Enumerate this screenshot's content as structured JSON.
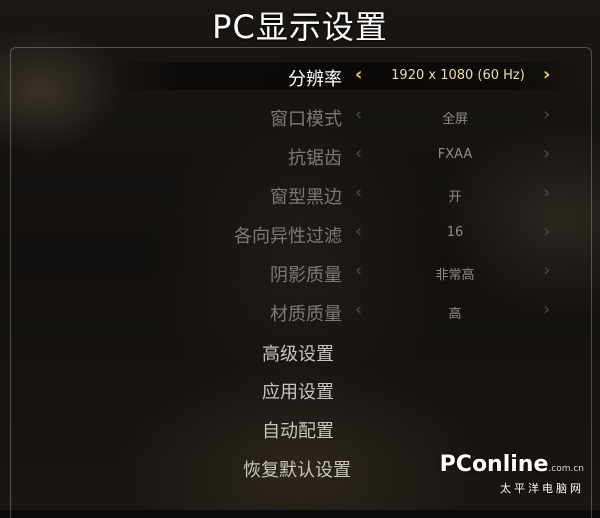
{
  "title": "PC显示设置",
  "settings": [
    {
      "label": "分辨率",
      "value": "1920 x 1080 (60 Hz)",
      "selected": true
    },
    {
      "label": "窗口模式",
      "value": "全屏",
      "selected": false
    },
    {
      "label": "抗锯齿",
      "value": "FXAA",
      "selected": false
    },
    {
      "label": "窗型黑边",
      "value": "开",
      "selected": false
    },
    {
      "label": "各向异性过滤",
      "value": "16",
      "selected": false
    },
    {
      "label": "阴影质量",
      "value": "非常高",
      "selected": false
    },
    {
      "label": "材质质量",
      "value": "高",
      "selected": false
    }
  ],
  "arrows": {
    "left": "‹",
    "right": "›"
  },
  "actions": [
    {
      "label": "高级设置"
    },
    {
      "label": "应用设置"
    },
    {
      "label": "自动配置"
    },
    {
      "label": "恢复默认设置"
    }
  ],
  "watermark": {
    "brand": "PConline",
    "domain": ".com.cn",
    "subtitle": "太平洋电脑网"
  },
  "colors": {
    "selected_arrow": "#f2d23a",
    "selected_label": "#ffffff",
    "dim_label": "#7d7a76"
  }
}
